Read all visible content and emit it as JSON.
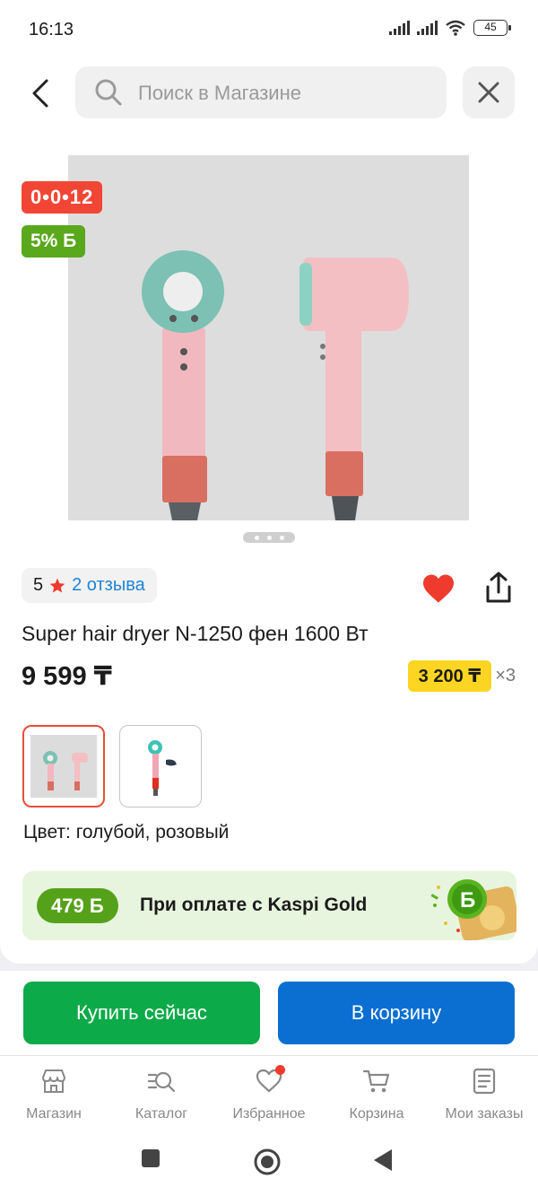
{
  "status_bar": {
    "time": "16:13",
    "battery": "45"
  },
  "search": {
    "placeholder": "Поиск в Магазине"
  },
  "badges": {
    "timer": "0•0•12",
    "bonus": "5% Б"
  },
  "rating": {
    "score": "5",
    "reviews_label": "2 отзыва"
  },
  "product": {
    "title": "Super hair dryer N-1250 фен 1600 Вт",
    "price": "9 599 ₸",
    "installment_amount": "3 200 ₸",
    "installment_multiplier": "×3",
    "color_label": "Цвет: голубой, розовый"
  },
  "kaspi_banner": {
    "bonus": "479 Б",
    "text": "При оплате с Kaspi Gold"
  },
  "actions": {
    "buy_now": "Купить сейчас",
    "add_to_cart": "В корзину"
  },
  "bottom_nav": {
    "items": [
      {
        "label": "Магазин",
        "icon": "store-icon"
      },
      {
        "label": "Каталог",
        "icon": "catalog-search-icon"
      },
      {
        "label": "Избранное",
        "icon": "heart-icon"
      },
      {
        "label": "Корзина",
        "icon": "cart-icon"
      },
      {
        "label": "Мои заказы",
        "icon": "orders-icon"
      }
    ]
  },
  "colors": {
    "timer_badge": "#f14635",
    "bonus_green": "#5aa81c",
    "installment_yellow": "#fbd521",
    "buy_now_green": "#0daa4a",
    "cart_blue": "#0a6fd1",
    "favorite_red": "#ef3b2e"
  }
}
